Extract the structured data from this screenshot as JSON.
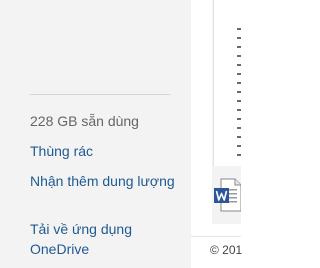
{
  "sidebar": {
    "storage_text": "228 GB sẵn dùng",
    "links": {
      "recycle_bin": "Thùng rác",
      "get_more_storage": "Nhận thêm dung lượng",
      "get_onedrive_apps": "Tải về ứng dụng OneDrive"
    }
  },
  "content": {
    "file_icon": "word-document-icon",
    "footer_text": "© 201"
  },
  "colors": {
    "sidebar_background": "#f3f3f3",
    "link": "#1f5a91",
    "muted_text": "#666666",
    "word_blue": "#2b579a"
  }
}
